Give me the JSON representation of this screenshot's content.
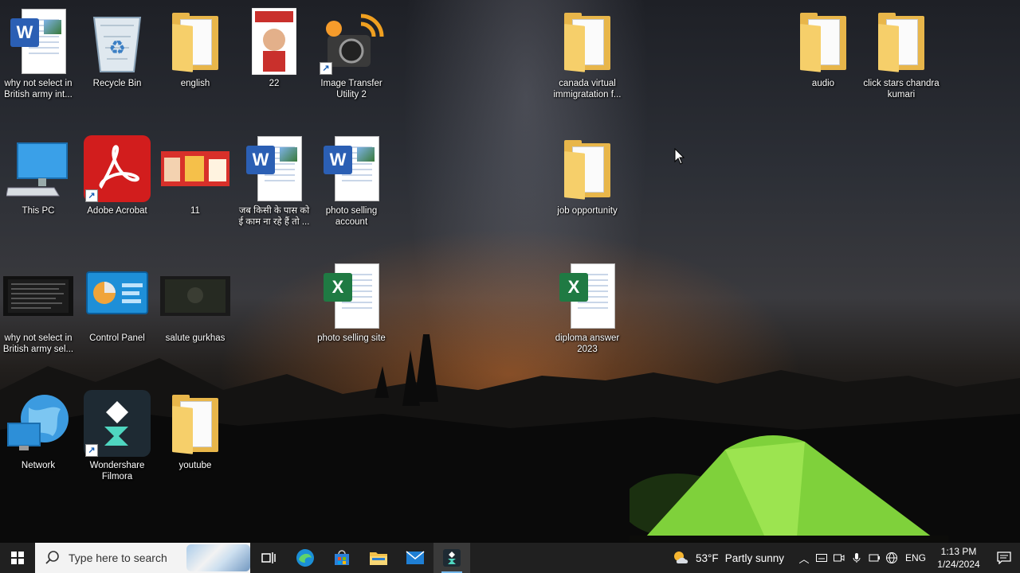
{
  "desktop": {
    "icons": [
      {
        "label": "why not select in British army int...",
        "type": "word-document"
      },
      {
        "label": "Recycle Bin",
        "type": "recycle-bin"
      },
      {
        "label": "english",
        "type": "folder"
      },
      {
        "label": "22",
        "type": "image"
      },
      {
        "label": "Image Transfer Utility 2",
        "type": "app-shortcut"
      },
      {
        "label": "canada virtual immigratation f...",
        "type": "folder"
      },
      {
        "label": "audio",
        "type": "folder"
      },
      {
        "label": "click stars chandra kumari",
        "type": "folder"
      },
      {
        "label": "This PC",
        "type": "this-pc"
      },
      {
        "label": "Adobe Acrobat",
        "type": "app-shortcut"
      },
      {
        "label": "11",
        "type": "image"
      },
      {
        "label": "जब किसी के पास को ई काम ना रहे हैं तो ...",
        "type": "word-document"
      },
      {
        "label": "photo selling account",
        "type": "word-document"
      },
      {
        "label": "job opportunity",
        "type": "folder"
      },
      {
        "label": "why not select in British army sel...",
        "type": "video"
      },
      {
        "label": "Control Panel",
        "type": "control-panel"
      },
      {
        "label": "salute gurkhas",
        "type": "video"
      },
      {
        "label": "photo selling site",
        "type": "excel-document"
      },
      {
        "label": "diploma answer 2023",
        "type": "excel-document"
      },
      {
        "label": "Network",
        "type": "network"
      },
      {
        "label": "Wondershare Filmora",
        "type": "app-shortcut"
      },
      {
        "label": "youtube",
        "type": "folder"
      }
    ]
  },
  "taskbar": {
    "search_placeholder": "Type here to search",
    "apps": [
      {
        "name": "task-view-icon"
      },
      {
        "name": "edge-icon"
      },
      {
        "name": "microsoft-store-icon"
      },
      {
        "name": "file-explorer-icon"
      },
      {
        "name": "mail-icon"
      },
      {
        "name": "filmora-icon"
      }
    ],
    "weather": {
      "temp": "53°F",
      "condition": "Partly sunny"
    },
    "language": "ENG",
    "time": "1:13 PM",
    "date": "1/24/2024"
  },
  "colors": {
    "taskbar_bg": "#202020",
    "folder": "#e8b64a",
    "word": "#2b5fb4",
    "excel": "#1f7a43",
    "acrobat": "#d21d1d",
    "tent": "#7fd13b"
  }
}
